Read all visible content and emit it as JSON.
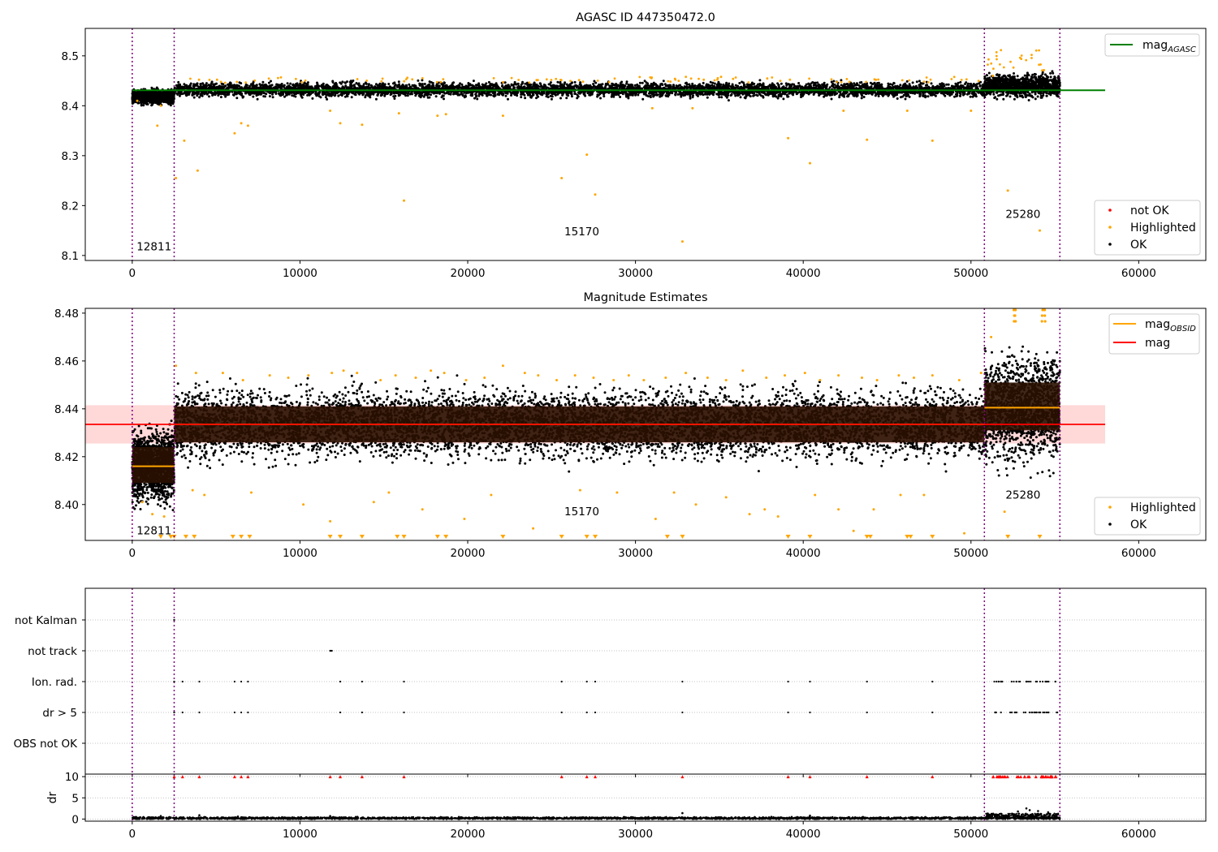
{
  "colors": {
    "ok": "#000000",
    "highlighted": "#ffa500",
    "not_ok": "#ff0000",
    "mag_agasc_line": "#008000",
    "mag_line": "#ff0000",
    "mag_obsid_line": "#ffa500",
    "mag_band": "#ffd8d8",
    "obsid_band": "#2a1000",
    "obs_separator": "#800080",
    "grid": "#b0b0b0"
  },
  "chart_data": [
    {
      "type": "scatter",
      "title": "AGASC ID 447350472.0",
      "xlim": [
        -2800,
        64000
      ],
      "ylim": [
        8.09,
        8.555
      ],
      "x_ticks": [
        0,
        10000,
        20000,
        30000,
        40000,
        50000,
        60000
      ],
      "y_ticks": [
        8.1,
        8.2,
        8.3,
        8.4,
        8.5
      ],
      "y_tick_labels": [
        "8.1",
        "8.2",
        "8.3",
        "8.4",
        "8.5"
      ],
      "observation_boundaries": [
        0,
        2500,
        50800,
        55300
      ],
      "observation_labels": [
        {
          "text": "12811",
          "x": 1300,
          "y": 8.11
        },
        {
          "text": "15170",
          "x": 26800,
          "y": 8.14
        },
        {
          "text": "25280",
          "x": 53100,
          "y": 8.175
        }
      ],
      "reference_lines": [
        {
          "name": "mag_AGASC",
          "y": 8.431,
          "x_range": [
            0,
            58000
          ],
          "color": "#008000"
        }
      ],
      "line_legend": {
        "placement": "top-right",
        "items": [
          {
            "name": "mag",
            "subscript": "AGASC"
          }
        ]
      },
      "point_legend": {
        "placement": "lower-right",
        "items": [
          "not OK",
          "Highlighted",
          "OK"
        ]
      },
      "ok_segments": [
        {
          "x": [
            0,
            2500
          ],
          "y_center": 8.418,
          "y_spread": 0.013
        },
        {
          "x": [
            2500,
            50800
          ],
          "y_center": 8.432,
          "y_spread": 0.013
        },
        {
          "x": [
            50800,
            55300
          ],
          "y_center": 8.44,
          "y_spread": 0.02
        }
      ],
      "highlighted": {
        "x": [
          300,
          1500,
          1700,
          2600,
          3100,
          3900,
          6100,
          6500,
          6900,
          11800,
          12400,
          13700,
          15900,
          16200,
          18200,
          18700,
          22100,
          25600,
          27100,
          27600,
          31000,
          32800,
          33400,
          39100,
          40400,
          42400,
          43800,
          46200,
          47700,
          50000,
          51300,
          52200,
          54100
        ],
        "y": [
          8.41,
          8.36,
          8.4,
          8.255,
          8.33,
          8.27,
          8.345,
          8.365,
          8.36,
          8.39,
          8.365,
          8.362,
          8.385,
          8.21,
          8.38,
          8.383,
          8.38,
          8.255,
          8.302,
          8.222,
          8.395,
          8.128,
          8.395,
          8.335,
          8.285,
          8.39,
          8.332,
          8.39,
          8.33,
          8.39,
          8.46,
          8.23,
          8.15
        ]
      }
    },
    {
      "type": "scatter",
      "title": "Magnitude Estimates",
      "xlim": [
        -2800,
        64000
      ],
      "ylim": [
        8.385,
        8.482
      ],
      "x_ticks": [
        0,
        10000,
        20000,
        30000,
        40000,
        50000,
        60000
      ],
      "y_ticks": [
        8.4,
        8.42,
        8.44,
        8.46,
        8.48
      ],
      "y_tick_labels": [
        "8.40",
        "8.42",
        "8.44",
        "8.46",
        "8.48"
      ],
      "observation_boundaries": [
        0,
        2500,
        50800,
        55300
      ],
      "observation_labels": [
        {
          "text": "12811",
          "x": 1300,
          "y": 8.3875
        },
        {
          "text": "15170",
          "x": 26800,
          "y": 8.3955
        },
        {
          "text": "25280",
          "x": 53100,
          "y": 8.4025
        }
      ],
      "mag": {
        "value": 8.4335,
        "band": [
          8.4255,
          8.4415
        ],
        "x_range": [
          -2800,
          58000
        ]
      },
      "mag_obsid": [
        {
          "x": [
            0,
            2500
          ],
          "y": 8.416,
          "band": [
            8.409,
            8.424
          ]
        },
        {
          "x": [
            2500,
            50800
          ],
          "y": 8.4335,
          "band": [
            8.426,
            8.441
          ]
        },
        {
          "x": [
            50800,
            55300
          ],
          "y": 8.4405,
          "band": [
            8.431,
            8.451
          ]
        }
      ],
      "line_legend": {
        "placement": "top-right",
        "items": [
          {
            "name": "mag",
            "subscript": "OBSID"
          },
          {
            "name": "mag",
            "subscript": ""
          }
        ]
      },
      "point_legend": {
        "placement": "lower-right",
        "items": [
          "Highlighted",
          "OK"
        ]
      },
      "ok_segments": [
        {
          "x": [
            0,
            2500
          ],
          "y_center": 8.416,
          "y_spread": 0.013
        },
        {
          "x": [
            2500,
            50800
          ],
          "y_center": 8.4335,
          "y_spread": 0.013
        },
        {
          "x": [
            50800,
            55300
          ],
          "y_center": 8.44,
          "y_spread": 0.02
        }
      ],
      "highlighted_upper_x": [
        2600,
        3800,
        5400,
        6600,
        8200,
        9300,
        10500,
        11900,
        12600,
        13400,
        14800,
        15700,
        16900,
        17800,
        18600,
        19900,
        21000,
        22100,
        23400,
        24200,
        25300,
        26400,
        27500,
        28700,
        29600,
        30500,
        31800,
        33000,
        34300,
        35400,
        36400,
        37800,
        38900,
        40100,
        41000,
        42100,
        43500,
        44400,
        45700,
        46600,
        47700,
        49300,
        50600,
        51200
      ],
      "highlighted_upper_y": [
        8.458,
        8.455,
        8.455,
        8.452,
        8.454,
        8.453,
        8.454,
        8.455,
        8.456,
        8.455,
        8.452,
        8.454,
        8.453,
        8.456,
        8.455,
        8.452,
        8.453,
        8.458,
        8.455,
        8.454,
        8.452,
        8.454,
        8.453,
        8.452,
        8.454,
        8.452,
        8.453,
        8.455,
        8.453,
        8.452,
        8.456,
        8.453,
        8.454,
        8.455,
        8.452,
        8.454,
        8.453,
        8.452,
        8.454,
        8.453,
        8.454,
        8.452,
        8.455,
        8.47
      ],
      "highlighted_lower_x": [
        600,
        1200,
        1900,
        3600,
        4300,
        7100,
        10200,
        11800,
        14400,
        15300,
        17300,
        19800,
        21400,
        23900,
        26700,
        28900,
        31200,
        32300,
        33600,
        35400,
        36800,
        37700,
        38500,
        40700,
        42100,
        43000,
        44200,
        45800,
        47200,
        49600,
        52000
      ],
      "highlighted_lower_y": [
        8.401,
        8.396,
        8.395,
        8.406,
        8.404,
        8.405,
        8.4,
        8.393,
        8.401,
        8.405,
        8.398,
        8.394,
        8.404,
        8.39,
        8.406,
        8.405,
        8.394,
        8.405,
        8.4,
        8.403,
        8.396,
        8.398,
        8.395,
        8.404,
        8.398,
        8.389,
        8.398,
        8.404,
        8.404,
        8.388,
        8.397
      ],
      "off_scale_low_x": [
        1700,
        2300,
        2500,
        3200,
        3700,
        6000,
        6500,
        7000,
        11800,
        12400,
        13700,
        15800,
        16200,
        18200,
        18700,
        22100,
        25600,
        27100,
        27600,
        31900,
        32800,
        39100,
        40400,
        43800,
        44000,
        46200,
        46400,
        47700,
        52200,
        54100
      ],
      "off_scale_high_x": [
        52600,
        52700,
        54300,
        54400
      ]
    },
    {
      "type": "scatter",
      "title": "",
      "xlim": [
        -2800,
        64000
      ],
      "categories": [
        "OBS not OK",
        "dr > 5",
        "Ion. rad.",
        "not track",
        "not Kalman"
      ],
      "flags": {
        "not Kalman": [
          2500
        ],
        "not track": [
          11800,
          11850,
          11900
        ],
        "Ion. rad.": [
          2500,
          3000,
          4000,
          6100,
          6500,
          6900,
          12400,
          13700,
          16200,
          25600,
          27100,
          27600,
          32800,
          39100,
          40400,
          43800,
          47700
        ],
        "dr > 5": [
          2500,
          3000,
          4000,
          6100,
          6500,
          6900,
          12400,
          13700,
          16200,
          25600,
          27100,
          27600,
          32800,
          39100,
          40400,
          43800,
          47700
        ],
        "OBS not OK": []
      },
      "flag_cluster": {
        "category_indices": [
          1,
          2
        ],
        "x_range": [
          51300,
          55200
        ]
      }
    },
    {
      "type": "scatter",
      "title": "",
      "ylabel": "dr",
      "xlim": [
        -2800,
        64000
      ],
      "ylim": [
        -0.5,
        10.6
      ],
      "x_ticks": [
        0,
        10000,
        20000,
        30000,
        40000,
        50000,
        60000
      ],
      "x_tick_labels": [
        "0",
        "10000",
        "20000",
        "30000",
        "40000",
        "50000",
        "60000"
      ],
      "y_ticks": [
        0,
        5,
        10
      ],
      "y_tick_labels": [
        "0",
        "5",
        "10"
      ],
      "clipped_at": 10,
      "clipped_x": [
        2500,
        3000,
        4000,
        6100,
        6500,
        6900,
        11800,
        12400,
        13700,
        16200,
        25600,
        27100,
        27600,
        32800,
        39100,
        40400,
        43800,
        47700
      ],
      "clipped_cluster_x": [
        51300,
        55200
      ],
      "dr_baseline": 0.2,
      "dr_spikes": [
        {
          "x": 1700,
          "y": 0.7
        },
        {
          "x": 4000,
          "y": 0.9
        },
        {
          "x": 6300,
          "y": 0.6
        },
        {
          "x": 11800,
          "y": 0.7
        },
        {
          "x": 32800,
          "y": 1.4
        },
        {
          "x": 40400,
          "y": 0.8
        },
        {
          "x": 51000,
          "y": 1.3
        },
        {
          "x": 52800,
          "y": 1.8
        },
        {
          "x": 53300,
          "y": 2.5
        },
        {
          "x": 53500,
          "y": 2.1
        },
        {
          "x": 54000,
          "y": 1.9
        },
        {
          "x": 54600,
          "y": 1.6
        }
      ]
    }
  ]
}
